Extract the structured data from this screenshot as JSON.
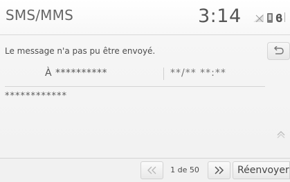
{
  "header": {
    "title": "SMS/MMS",
    "time": "3:14",
    "icons": [
      "signal-icon",
      "phone-icon",
      "bluetooth-icon",
      "extra-status-icon"
    ]
  },
  "message": {
    "error": "Le message n'a pas pu être envoyé.",
    "recipient": "À **********",
    "datetime": "**/** **:**",
    "body": "************"
  },
  "controls": {
    "back_icon": "back-arrow-icon",
    "prev_icon": "double-chevron-left-icon",
    "next_icon": "double-chevron-right-icon",
    "scroll_up_icon": "chevron-up-icon",
    "scroll_down_icon": "chevron-down-icon",
    "page_indicator": "1 de 50",
    "resend_label": "Réenvoyer"
  },
  "colors": {
    "background": "#f1f1f1",
    "text": "#4a4a4a",
    "divider": "#d4d4d4"
  }
}
